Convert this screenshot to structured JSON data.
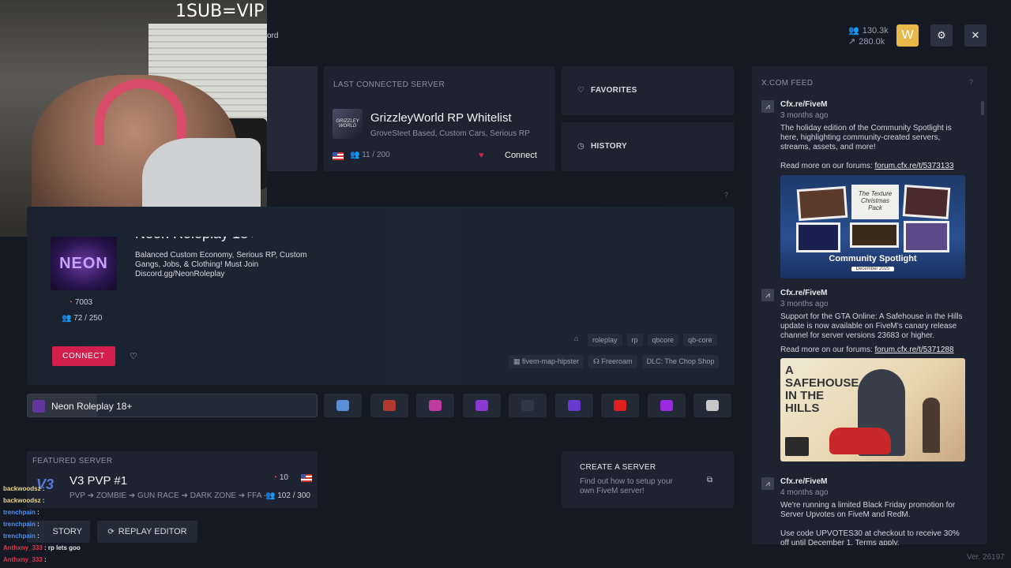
{
  "overlay": {
    "banner": "1SUB=VIP",
    "partial_text": "ord"
  },
  "topbar": {
    "players_online": "130.3k",
    "servers_count": "280.0k",
    "avatar_letter": "W",
    "settings_icon": "gear-icon",
    "close_icon": "close-icon"
  },
  "last_connected": {
    "header": "LAST CONNECTED SERVER",
    "name": "GrizzleyWorld RP Whitelist",
    "description": "GroveSteet Based, Custom Cars, Serious RP",
    "players": "11 / 200",
    "connect_label": "Connect",
    "logo_text": "GRIZZLEY WORLD"
  },
  "favorites": {
    "label": "FAVORITES"
  },
  "history": {
    "label": "HISTORY"
  },
  "spotlight": {
    "name_partial": "Neon Roleplay 18+",
    "logo_text": "NEON",
    "description": "Balanced Custom Economy, Serious RP, Custom Gangs, Jobs, & Clothing! Must Join Discord.gg/NeonRoleplay",
    "upvotes": "7003",
    "players": "72 / 250",
    "connect_label": "CONNECT",
    "tags": [
      "roleplay",
      "rp",
      "qbcore",
      "qb-core"
    ],
    "resources": [
      "fivem-map-hipster",
      "Freeroam",
      "DLC: The Chop Shop"
    ]
  },
  "server_strip": {
    "selected_name": "Neon Roleplay 18+",
    "colors": [
      "#5a8fd8",
      "#b03a2e",
      "#c03aa0",
      "#8a3ad0",
      "#303848",
      "#6a3ad0",
      "#e02020",
      "#9a2ae0",
      "#c8c8c8"
    ]
  },
  "featured": {
    "header": "FEATURED SERVER",
    "name": "V3 PVP #1",
    "description": "PVP ➔ ZOMBIE ➔ GUN RACE ➔ DARK ZONE ➔ FFA -",
    "upvotes": "10",
    "players": "102 / 300"
  },
  "create_server": {
    "title": "CREATE A SERVER",
    "description": "Find out how to setup your own FiveM server!"
  },
  "bottom_buttons": {
    "story_label": "STORY",
    "replay_label": "REPLAY EDITOR"
  },
  "feed": {
    "header": "X.COM FEED",
    "items": [
      {
        "author": "Cfx.re/FiveM",
        "time": "3 months ago",
        "text": "The holiday edition of the Community Spotlight is here, highlighting community-created servers, streams, assets, and more!",
        "read_more": "Read more on our forums:",
        "link": "forum.cfx.re/t/5373133",
        "image_caption": "Community Spotlight",
        "image_sub": "December 2025",
        "image_title": "The Texture Christmas Pack"
      },
      {
        "author": "Cfx.re/FiveM",
        "time": "3 months ago",
        "text": "Support for the GTA Online: A Safehouse in the Hills update is now available on FiveM's canary release channel for server versions 23683 or higher.",
        "read_more": "Read more on our forums:",
        "link": "forum.cfx.re/t/5371288",
        "image_title": "A SAFEHOUSE IN THE HILLS"
      },
      {
        "author": "Cfx.re/FiveM",
        "time": "4 months ago",
        "text": "We're running a limited Black Friday promotion for Server Upvotes on FiveM and RedM.",
        "text2": "Use code UPVOTES30 at checkout to receive 30% off until December 1. Terms apply."
      }
    ]
  },
  "chat": [
    {
      "user": "backwoodsz",
      "msg": "",
      "color": "n1"
    },
    {
      "user": "backwoodsz",
      "msg": "",
      "color": "n1"
    },
    {
      "user": "trenchpain",
      "msg": "",
      "color": "n2"
    },
    {
      "user": "trenchpain",
      "msg": "",
      "color": "n2"
    },
    {
      "user": "trenchpain",
      "msg": "",
      "color": "n2"
    },
    {
      "user": "Anthxny_333",
      "msg": "rp lets goo",
      "color": "n3"
    },
    {
      "user": "Anthxny_333",
      "msg": "",
      "color": "n3"
    }
  ],
  "version": "Ver. 26197"
}
